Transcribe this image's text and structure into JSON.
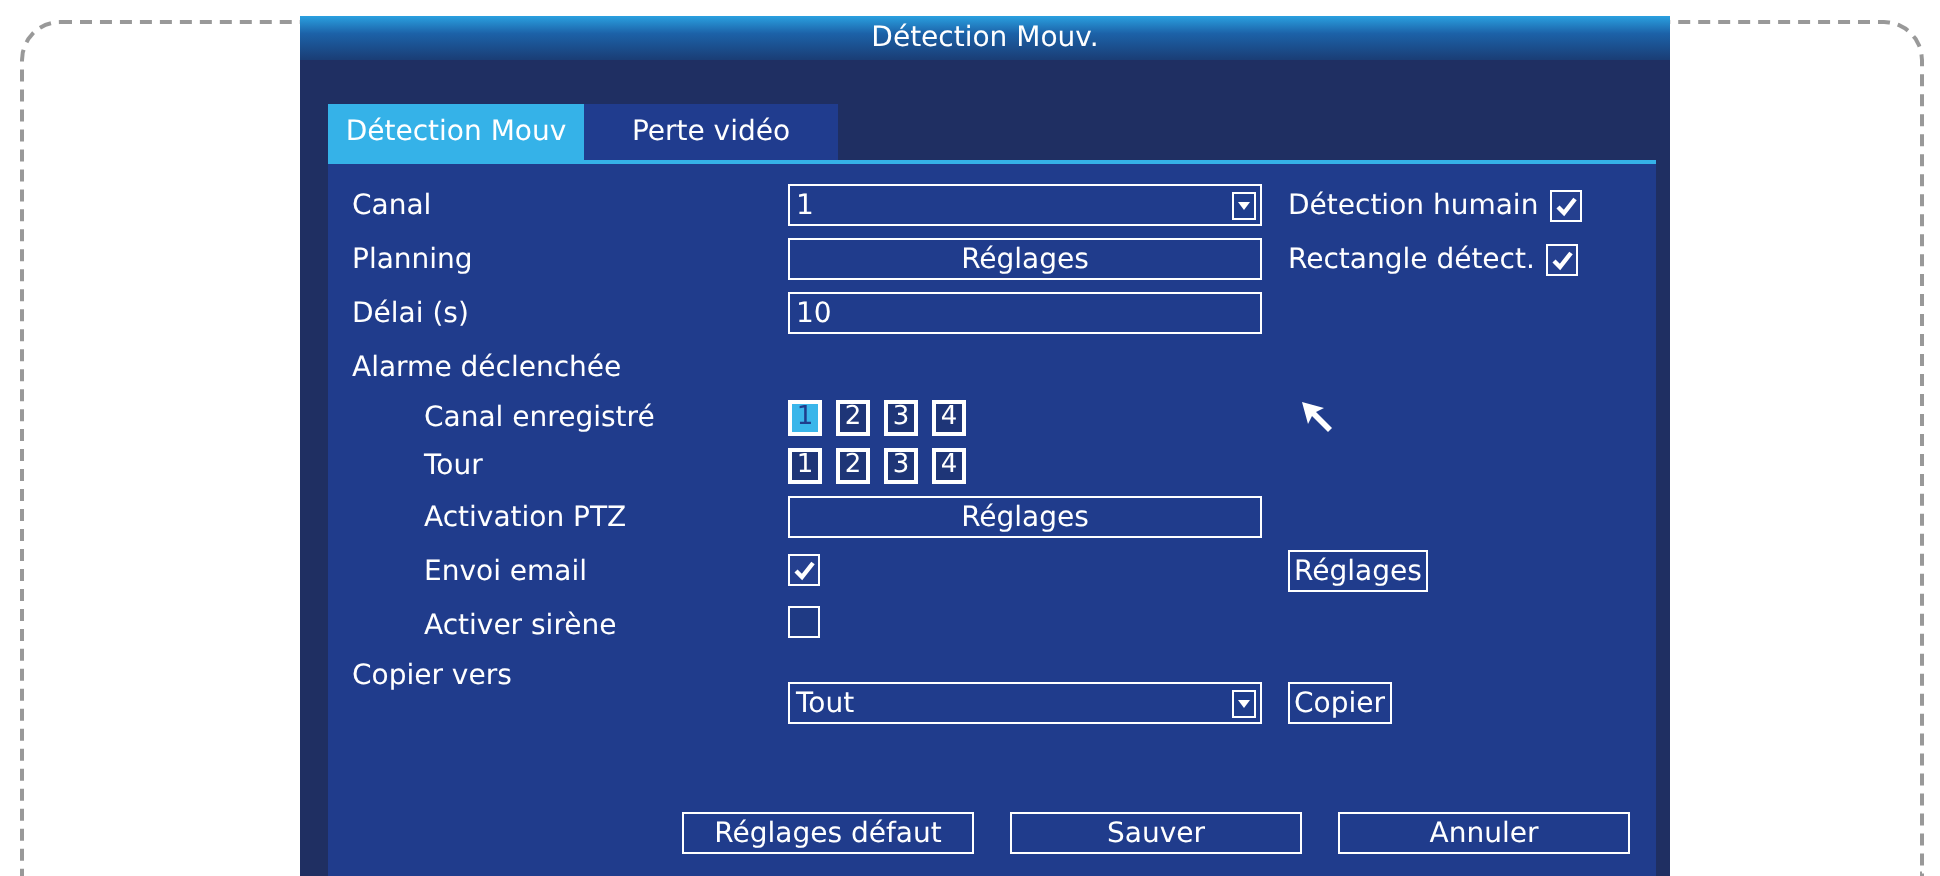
{
  "title": "Détection Mouv.",
  "tabs": [
    {
      "label": "Détection Mouv",
      "selected": true
    },
    {
      "label": "Perte vidéo",
      "selected": false
    }
  ],
  "channel": {
    "label": "Canal",
    "value": "1"
  },
  "schedule": {
    "label": "Planning",
    "button": "Réglages"
  },
  "delay": {
    "label": "Délai (s)",
    "value": "10"
  },
  "human_detection": {
    "label": "Détection humain",
    "checked": true
  },
  "rectangle": {
    "label": "Rectangle détect.",
    "checked": true
  },
  "alarm": {
    "label": "Alarme déclenchée"
  },
  "record_channel": {
    "label": "Canal enregistré",
    "channels": [
      {
        "label": "1",
        "selected": true
      },
      {
        "label": "2",
        "selected": false
      },
      {
        "label": "3",
        "selected": false
      },
      {
        "label": "4",
        "selected": false
      }
    ]
  },
  "tour": {
    "label": "Tour",
    "channels": [
      {
        "label": "1",
        "selected": false
      },
      {
        "label": "2",
        "selected": false
      },
      {
        "label": "3",
        "selected": false
      },
      {
        "label": "4",
        "selected": false
      }
    ]
  },
  "ptz": {
    "label": "Activation PTZ",
    "button": "Réglages"
  },
  "email": {
    "label": "Envoi email",
    "checked": true,
    "button": "Réglages"
  },
  "siren": {
    "label": "Activer sirène",
    "checked": false
  },
  "copy": {
    "label": "Copier vers",
    "value": "Tout",
    "button": "Copier"
  },
  "buttons": [
    "Réglages défaut",
    "Sauver",
    "Annuler"
  ]
}
